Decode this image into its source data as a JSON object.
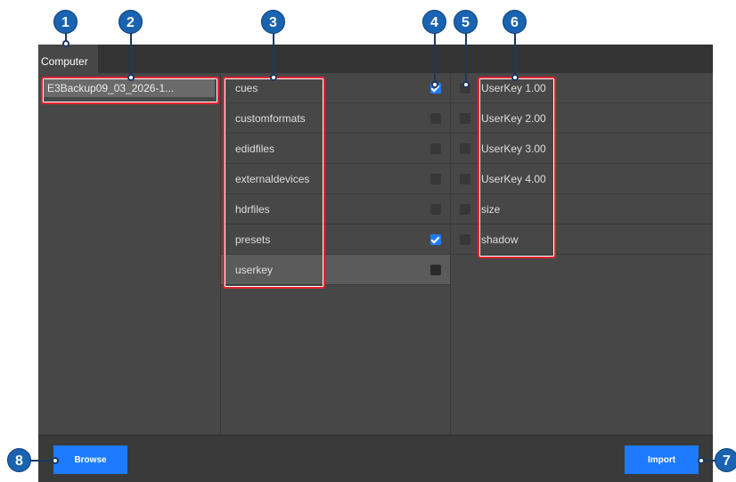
{
  "tabs": [
    {
      "label": "Computer"
    }
  ],
  "left_panel": {
    "items": [
      {
        "label": "E3Backup09_03_2026-1..."
      }
    ]
  },
  "middle_panel": {
    "items": [
      {
        "label": "cues",
        "checked": true
      },
      {
        "label": "customformats",
        "checked": false
      },
      {
        "label": "edidfiles",
        "checked": false
      },
      {
        "label": "externaldevices",
        "checked": false
      },
      {
        "label": "hdrfiles",
        "checked": false
      },
      {
        "label": "presets",
        "checked": true
      },
      {
        "label": "userkey",
        "checked": false,
        "selected": true
      }
    ]
  },
  "right_panel": {
    "items": [
      {
        "label": "UserKey 1.00",
        "checked": false
      },
      {
        "label": "UserKey 2.00",
        "checked": false
      },
      {
        "label": "UserKey 3.00",
        "checked": false
      },
      {
        "label": "UserKey 4.00",
        "checked": false
      },
      {
        "label": "size",
        "checked": false
      },
      {
        "label": "shadow",
        "checked": false
      }
    ]
  },
  "footer": {
    "browse_label": "Browse",
    "import_label": "Import"
  },
  "annotations": [
    "1",
    "2",
    "3",
    "4",
    "5",
    "6",
    "7",
    "8"
  ],
  "colors": {
    "accent": "#1e7bff",
    "highlight": "#e8222e",
    "badge": "#1a63b0"
  }
}
